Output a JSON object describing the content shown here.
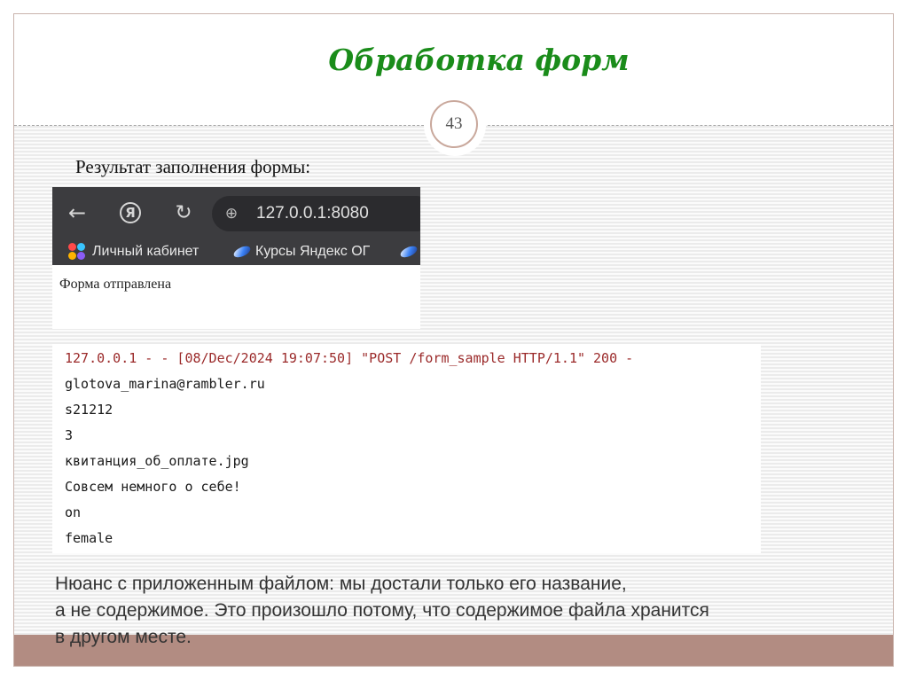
{
  "slide": {
    "title": "Обработка форм",
    "page_number": "43",
    "result_label": "Результат заполнения формы:",
    "accent_color": "#1a8c1a",
    "band_color": "#b28c82"
  },
  "browser": {
    "address": "127.0.0.1:8080",
    "bookmarks": [
      "Личный кабинет",
      "Курсы Яндекс ОГ"
    ],
    "page_text": "Форма отправлена",
    "icons": [
      "back-arrow-icon",
      "yandex-icon",
      "reload-icon",
      "globe-icon"
    ]
  },
  "terminal": {
    "lines": [
      "127.0.0.1 - - [08/Dec/2024 19:07:50] \"POST /form_sample HTTP/1.1\" 200 -",
      "glotova_marina@rambler.ru",
      "s21212",
      "3",
      "квитанция_об_оплате.jpg",
      "Совсем немного о себе!",
      "on",
      "female"
    ]
  },
  "note": {
    "lines": [
      "Нюанс с приложенным файлом: мы достали только его название,",
      "а не содержимое. Это произошло потому, что содержимое файла хранится",
      "в другом месте."
    ]
  }
}
